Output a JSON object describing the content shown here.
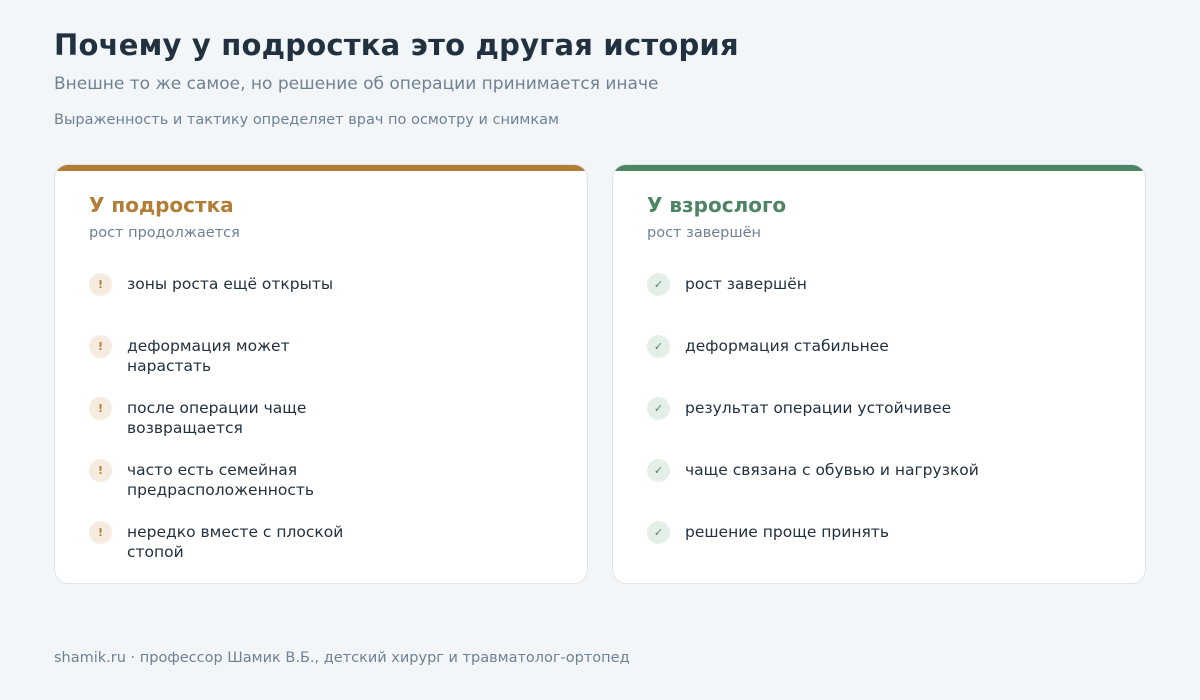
{
  "header": {
    "title": "Почему у подростка это другая история",
    "subtitle": "Внешне то же самое, но решение об операции принимается иначе",
    "note": "Выраженность и тактику определяет врач по осмотру и снимкам"
  },
  "colors": {
    "teen_accent": "#b27d34",
    "adult_accent": "#4d8564"
  },
  "teen_card": {
    "title": "У подростка",
    "subtitle": "рост продолжается",
    "icon": "warning-icon",
    "items": [
      {
        "symbol": "!",
        "text": "зоны роста ещё открыты"
      },
      {
        "symbol": "!",
        "text": "деформация может нарастать"
      },
      {
        "symbol": "!",
        "text": "после операции чаще возвращается"
      },
      {
        "symbol": "!",
        "text": "часто есть семейная предрасположенность"
      },
      {
        "symbol": "!",
        "text": "нередко вместе с плоской стопой"
      }
    ]
  },
  "adult_card": {
    "title": "У взрослого",
    "subtitle": "рост завершён",
    "icon": "check-icon",
    "items": [
      {
        "symbol": "✓",
        "text": "рост завершён"
      },
      {
        "symbol": "✓",
        "text": "деформация стабильнее"
      },
      {
        "symbol": "✓",
        "text": "результат операции устойчивее"
      },
      {
        "symbol": "✓",
        "text": "чаще связана с обувью и нагрузкой"
      },
      {
        "symbol": "✓",
        "text": "решение проще принять"
      }
    ]
  },
  "footer": {
    "text": "shamik.ru · профессор Шамик В.Б., детский хирург и травматолог-ортопед"
  }
}
